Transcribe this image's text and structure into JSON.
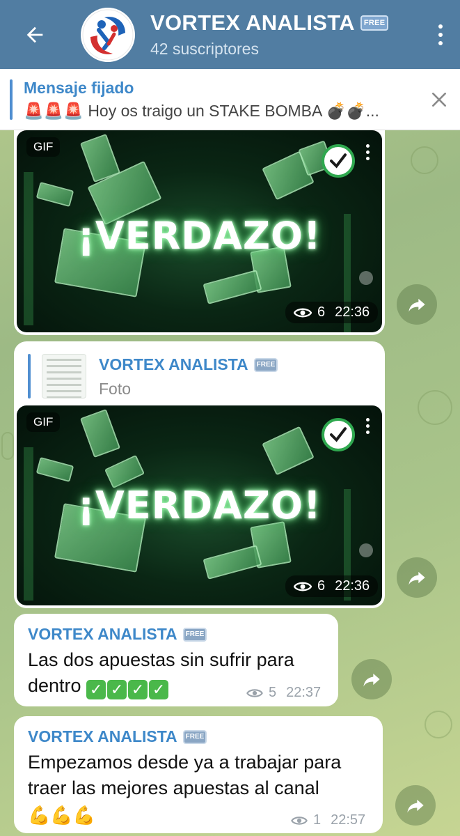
{
  "header": {
    "title": "VORTEX ANALISTA",
    "title_badge": "FREE",
    "subtitle": "42 suscriptores",
    "colors": {
      "bar": "#517da2",
      "text": "#ffffff"
    }
  },
  "pinned": {
    "label": "Mensaje fijado",
    "emoji_prefix": "🚨🚨🚨",
    "text": "Hoy os traigo un STAKE BOMBA",
    "emoji_suffix": "💣💣...",
    "accent": "#3e88c9"
  },
  "messages": [
    {
      "type": "gif",
      "gif_label": "GIF",
      "overlay_text": "¡VERDAZO!",
      "views": "6",
      "time": "22:36"
    },
    {
      "type": "forwarded_gif",
      "reply_sender": "VORTEX ANALISTA",
      "reply_badge": "FREE",
      "reply_preview": "Foto",
      "gif_label": "GIF",
      "overlay_text": "¡VERDAZO!",
      "views": "6",
      "time": "22:36"
    },
    {
      "type": "text",
      "sender": "VORTEX ANALISTA",
      "sender_badge": "FREE",
      "text": "Las dos apuestas sin sufrir para dentro",
      "emoji": "✅✅✅✅",
      "views": "5",
      "time": "22:37"
    },
    {
      "type": "text",
      "sender": "VORTEX ANALISTA",
      "sender_badge": "FREE",
      "text": "Empezamos desde ya a trabajar para traer las mejores apuestas al canal",
      "emoji": "💪💪💪",
      "views": "1",
      "time": "22:57"
    }
  ]
}
